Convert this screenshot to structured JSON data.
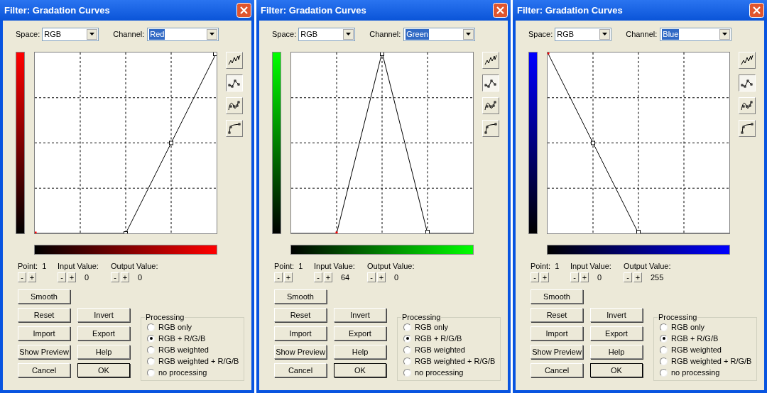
{
  "dialogs": [
    {
      "title": "Filter: Gradation Curves",
      "kind": "red",
      "space_label": "Space:",
      "space": "RGB",
      "channel_label": "Channel:",
      "channel": "Red",
      "tools": [
        {
          "selected": false
        },
        {
          "selected": true
        },
        {
          "selected": false
        },
        {
          "selected": false
        }
      ],
      "fields": [
        {
          "kind": "inline",
          "label": "Point:",
          "value": "1",
          "buttons": [
            "-",
            "+"
          ]
        },
        {
          "kind": "below",
          "label": "Input Value:",
          "value": "0",
          "buttons": [
            "-",
            "+"
          ]
        },
        {
          "kind": "below",
          "label": "Output Value:",
          "value": "0",
          "buttons": [
            "-",
            "+"
          ]
        }
      ],
      "buttons": [
        {
          "label": "Smooth",
          "default": false
        },
        {
          "label": "Reset",
          "default": false
        },
        {
          "label": "Invert",
          "default": false
        },
        {
          "label": "Import",
          "default": false
        },
        {
          "label": "Export",
          "default": false
        },
        {
          "label": "Show Preview",
          "default": false
        },
        {
          "label": "Help",
          "default": false
        },
        {
          "label": "Cancel",
          "default": false
        },
        {
          "label": "OK",
          "default": true
        }
      ],
      "processing": {
        "title": "Processing",
        "options": [
          {
            "label": "RGB only",
            "selected": false
          },
          {
            "label": "RGB + R/G/B",
            "selected": true
          },
          {
            "label": "RGB weighted",
            "selected": false
          },
          {
            "label": "RGB weighted + R/G/B",
            "selected": false
          },
          {
            "label": "no processing",
            "selected": false
          }
        ]
      }
    },
    {
      "title": "Filter: Gradation Curves",
      "kind": "green",
      "space_label": "Space:",
      "space": "RGB",
      "channel_label": "Channel:",
      "channel": "Green",
      "tools": [
        {
          "selected": false
        },
        {
          "selected": true
        },
        {
          "selected": false
        },
        {
          "selected": false
        }
      ],
      "fields": [
        {
          "kind": "inline",
          "label": "Point:",
          "value": "1",
          "buttons": [
            "-",
            "+"
          ]
        },
        {
          "kind": "below",
          "label": "Input Value:",
          "value": "64",
          "buttons": [
            "-",
            "+"
          ]
        },
        {
          "kind": "below",
          "label": "Output Value:",
          "value": "0",
          "buttons": [
            "-",
            "+"
          ]
        }
      ],
      "buttons": [
        {
          "label": "Smooth",
          "default": false
        },
        {
          "label": "Reset",
          "default": false
        },
        {
          "label": "Invert",
          "default": false
        },
        {
          "label": "Import",
          "default": false
        },
        {
          "label": "Export",
          "default": false
        },
        {
          "label": "Show Preview",
          "default": false
        },
        {
          "label": "Help",
          "default": false
        },
        {
          "label": "Cancel",
          "default": false
        },
        {
          "label": "OK",
          "default": true
        }
      ],
      "processing": {
        "title": "Processing",
        "options": [
          {
            "label": "RGB only",
            "selected": false
          },
          {
            "label": "RGB + R/G/B",
            "selected": true
          },
          {
            "label": "RGB weighted",
            "selected": false
          },
          {
            "label": "RGB weighted + R/G/B",
            "selected": false
          },
          {
            "label": "no processing",
            "selected": false
          }
        ]
      }
    },
    {
      "title": "Filter: Gradation Curves",
      "kind": "blue",
      "space_label": "Space:",
      "space": "RGB",
      "channel_label": "Channel:",
      "channel": "Blue",
      "tools": [
        {
          "selected": false
        },
        {
          "selected": true
        },
        {
          "selected": false
        },
        {
          "selected": false
        }
      ],
      "fields": [
        {
          "kind": "inline",
          "label": "Point:",
          "value": "1",
          "buttons": [
            "-",
            "+"
          ]
        },
        {
          "kind": "below",
          "label": "Input Value:",
          "value": "0",
          "buttons": [
            "-",
            "+"
          ]
        },
        {
          "kind": "below",
          "label": "Output Value:",
          "value": "255",
          "buttons": [
            "-",
            "+"
          ]
        }
      ],
      "buttons": [
        {
          "label": "Smooth",
          "default": false
        },
        {
          "label": "Reset",
          "default": false
        },
        {
          "label": "Invert",
          "default": false
        },
        {
          "label": "Import",
          "default": false
        },
        {
          "label": "Export",
          "default": false
        },
        {
          "label": "Show Preview",
          "default": false
        },
        {
          "label": "Help",
          "default": false
        },
        {
          "label": "Cancel",
          "default": false
        },
        {
          "label": "OK",
          "default": true
        }
      ],
      "processing": {
        "title": "Processing",
        "options": [
          {
            "label": "RGB only",
            "selected": false
          },
          {
            "label": "RGB + R/G/B",
            "selected": true
          },
          {
            "label": "RGB weighted",
            "selected": false
          },
          {
            "label": "RGB weighted + R/G/B",
            "selected": false
          },
          {
            "label": "no processing",
            "selected": false
          }
        ]
      }
    }
  ]
}
